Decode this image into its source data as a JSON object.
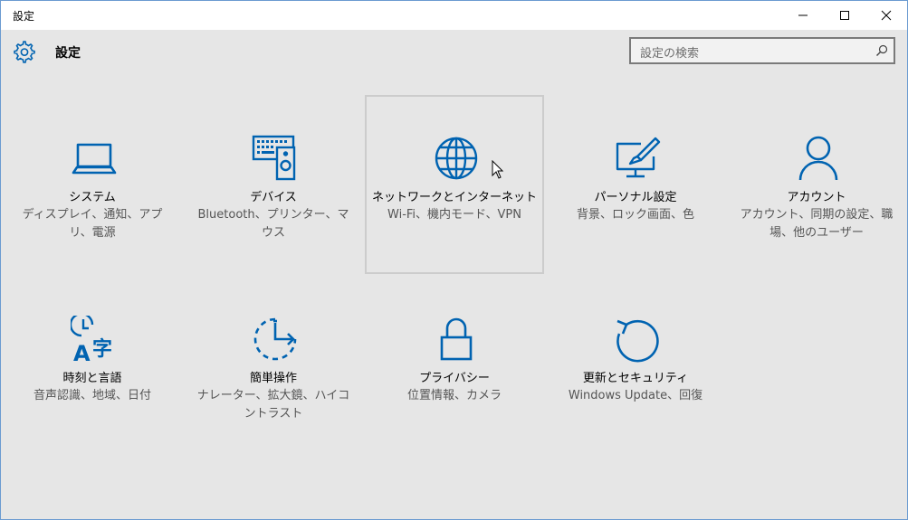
{
  "window": {
    "title": "設定"
  },
  "header": {
    "title": "設定"
  },
  "search": {
    "placeholder": "設定の検索"
  },
  "accent_color": "#0063b1",
  "tiles": [
    {
      "title": "システム",
      "desc": "ディスプレイ、通知、アプリ、電源",
      "icon": "laptop-icon"
    },
    {
      "title": "デバイス",
      "desc": "Bluetooth、プリンター、マウス",
      "icon": "devices-icon"
    },
    {
      "title": "ネットワークとインターネット",
      "desc": "Wi-Fi、機内モード、VPN",
      "icon": "globe-icon"
    },
    {
      "title": "パーソナル設定",
      "desc": "背景、ロック画面、色",
      "icon": "personalization-icon"
    },
    {
      "title": "アカウント",
      "desc": "アカウント、同期の設定、職場、他のユーザー",
      "icon": "person-icon"
    },
    {
      "title": "時刻と言語",
      "desc": "音声認識、地域、日付",
      "icon": "time-language-icon"
    },
    {
      "title": "簡単操作",
      "desc": "ナレーター、拡大鏡、ハイコントラスト",
      "icon": "ease-of-access-icon"
    },
    {
      "title": "プライバシー",
      "desc": "位置情報、カメラ",
      "icon": "lock-icon"
    },
    {
      "title": "更新とセキュリティ",
      "desc": "Windows Update、回復",
      "icon": "update-icon"
    }
  ]
}
